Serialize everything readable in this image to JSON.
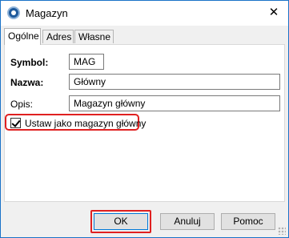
{
  "window": {
    "title": "Magazyn",
    "close_glyph": "✕"
  },
  "tabs": [
    {
      "label": "Ogólne",
      "active": true
    },
    {
      "label": "Adres",
      "active": false
    },
    {
      "label": "Własne",
      "active": false
    }
  ],
  "form": {
    "symbol_label": "Symbol:",
    "symbol_value": "MAG",
    "name_label": "Nazwa:",
    "name_value": "Główny",
    "desc_label": "Opis:",
    "desc_value": "Magazyn główny",
    "main_checkbox_label": "Ustaw jako magazyn główny",
    "main_checkbox_checked": true
  },
  "buttons": {
    "ok": "OK",
    "cancel": "Anuluj",
    "help": "Pomoc"
  },
  "colors": {
    "window_border": "#1a73c8",
    "highlight": "#e02020"
  }
}
